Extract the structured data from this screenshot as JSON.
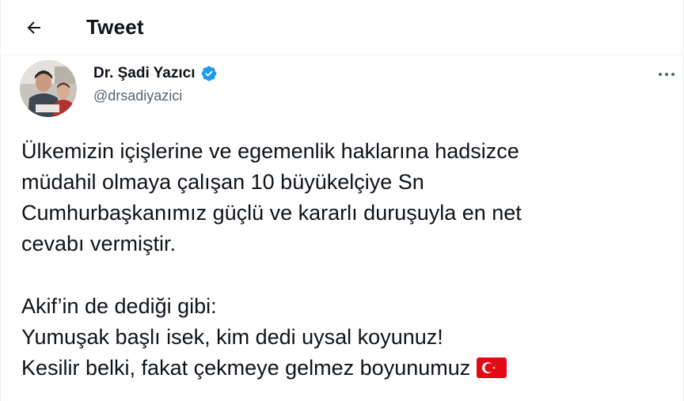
{
  "header": {
    "back_icon": "arrow-left-icon",
    "title": "Tweet"
  },
  "author": {
    "display_name": "Dr. Şadi Yazıcı",
    "verified_icon": "verified-badge-icon",
    "handle": "@drsadiyazici"
  },
  "more_icon": "more-horizontal-icon",
  "tweet": {
    "paragraph1": [
      "Ülkemizin içişlerine ve egemenlik haklarına hadsizce",
      "müdahil olmaya çalışan 10 büyükelçiye Sn",
      "Cumhurbaşkanımız güçlü ve kararlı duruşuyla en net",
      "cevabı vermiştir."
    ],
    "paragraph2": [
      "Akif’in de dediği gibi:",
      "Yumuşak başlı isek, kim dedi uysal koyunuz!",
      "Kesilir belki, fakat çekmeye gelmez boyunumuz"
    ],
    "emoji": "turkey-flag-emoji"
  },
  "colors": {
    "text": "#0f1419",
    "secondary": "#536471",
    "verified": "#1d9bf0",
    "divider": "#eff3f4",
    "flag_red": "#e30a17"
  }
}
